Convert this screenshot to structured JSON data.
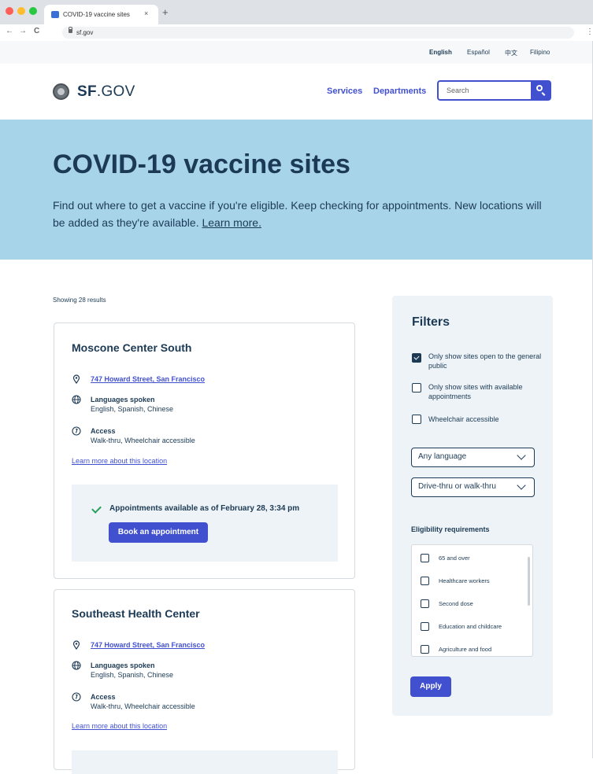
{
  "browser": {
    "tab_title": "COVID-19 vaccine sites",
    "tab_close": "×",
    "new_tab": "+",
    "url": "sf.gov",
    "back": "←",
    "forward": "→",
    "reload": "C",
    "menu": "⋮",
    "colors": {
      "close": "#ff5f57",
      "minimize": "#febc2e",
      "maximize": "#28c840"
    }
  },
  "languages": [
    "English",
    "Español",
    "中文",
    "Filipino"
  ],
  "header": {
    "logo_bold": "SF",
    "logo_rest": ".GOV",
    "nav": [
      "Services",
      "Departments"
    ],
    "search_placeholder": "Search"
  },
  "hero": {
    "title": "COVID-19 vaccine sites",
    "text": "Find out where to get a vaccine if you're eligible. Keep checking for appointments. New locations will be added as they're available.",
    "link": "Learn more."
  },
  "results": {
    "count_label": "Showing 28 results",
    "sites": [
      {
        "name": "Moscone Center South",
        "address": "747 Howard Street, San Francisco",
        "languages_label": "Languages spoken",
        "languages": "English, Spanish, Chinese",
        "access_label": "Access",
        "access": "Walk-thru, Wheelchair accessible",
        "learn_more": "Learn more about this location",
        "availability": "Appointments available as of February 28, 3:34 pm",
        "book": "Book an appointment"
      },
      {
        "name": "Southeast Health Center",
        "address": "747 Howard Street, San Francisco",
        "languages_label": "Languages spoken",
        "languages": "English, Spanish, Chinese",
        "access_label": "Access",
        "access": "Walk-thru, Wheelchair accessible",
        "learn_more": "Learn more about this location"
      }
    ]
  },
  "filters": {
    "title": "Filters",
    "checkboxes": [
      {
        "label": "Only show sites open to the general public",
        "checked": true
      },
      {
        "label": "Only show sites with available appointments",
        "checked": false
      },
      {
        "label": "Wheelchair accessible",
        "checked": false
      }
    ],
    "language_select": "Any language",
    "access_select": "Drive-thru or walk-thru",
    "eligibility_title": "Eligibility requirements",
    "eligibility": [
      "65 and over",
      "Healthcare workers",
      "Second dose",
      "Education and childcare",
      "Agriculture and food"
    ],
    "apply": "Apply"
  }
}
